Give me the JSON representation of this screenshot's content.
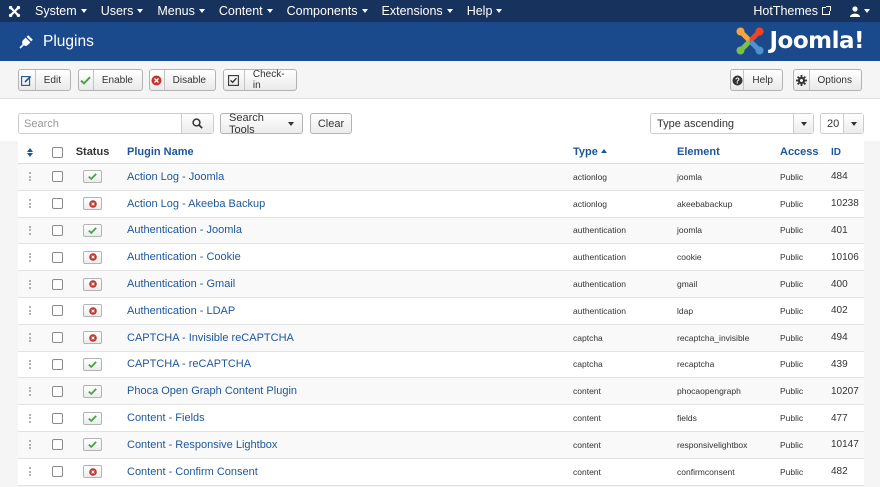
{
  "nav": {
    "menu": [
      "System",
      "Users",
      "Menus",
      "Content",
      "Components",
      "Extensions",
      "Help"
    ],
    "site_name": "HotThemes"
  },
  "header": {
    "title": "Plugins",
    "brand": "Joomla!"
  },
  "toolbar": {
    "edit": "Edit",
    "enable": "Enable",
    "disable": "Disable",
    "checkin": "Check-in",
    "help": "Help",
    "options": "Options"
  },
  "filters": {
    "search_placeholder": "Search",
    "search_tools": "Search Tools",
    "clear": "Clear",
    "ordering": "Type ascending",
    "limit": "20"
  },
  "columns": {
    "status": "Status",
    "name": "Plugin Name",
    "type": "Type",
    "element": "Element",
    "access": "Access",
    "id": "ID"
  },
  "plugins": [
    {
      "enabled": true,
      "name": "Action Log - Joomla",
      "type": "actionlog",
      "element": "joomla",
      "access": "Public",
      "id": "484"
    },
    {
      "enabled": false,
      "name": "Action Log - Akeeba Backup",
      "type": "actionlog",
      "element": "akeebabackup",
      "access": "Public",
      "id": "10238"
    },
    {
      "enabled": true,
      "name": "Authentication - Joomla",
      "type": "authentication",
      "element": "joomla",
      "access": "Public",
      "id": "401"
    },
    {
      "enabled": false,
      "name": "Authentication - Cookie",
      "type": "authentication",
      "element": "cookie",
      "access": "Public",
      "id": "10106"
    },
    {
      "enabled": false,
      "name": "Authentication - Gmail",
      "type": "authentication",
      "element": "gmail",
      "access": "Public",
      "id": "400"
    },
    {
      "enabled": false,
      "name": "Authentication - LDAP",
      "type": "authentication",
      "element": "ldap",
      "access": "Public",
      "id": "402"
    },
    {
      "enabled": false,
      "name": "CAPTCHA - Invisible reCAPTCHA",
      "type": "captcha",
      "element": "recaptcha_invisible",
      "access": "Public",
      "id": "494"
    },
    {
      "enabled": true,
      "name": "CAPTCHA - reCAPTCHA",
      "type": "captcha",
      "element": "recaptcha",
      "access": "Public",
      "id": "439"
    },
    {
      "enabled": true,
      "name": "Phoca Open Graph Content Plugin",
      "type": "content",
      "element": "phocaopengraph",
      "access": "Public",
      "id": "10207"
    },
    {
      "enabled": true,
      "name": "Content - Fields",
      "type": "content",
      "element": "fields",
      "access": "Public",
      "id": "477"
    },
    {
      "enabled": true,
      "name": "Content - Responsive Lightbox",
      "type": "content",
      "element": "responsivelightbox",
      "access": "Public",
      "id": "10147"
    },
    {
      "enabled": false,
      "name": "Content - Confirm Consent",
      "type": "content",
      "element": "confirmconsent",
      "access": "Public",
      "id": "482"
    }
  ],
  "colors": {
    "navbar": "#17325c",
    "header": "#1a4a8c",
    "link": "#1e5799",
    "enabled": "#46a546",
    "disabled": "#bd362f"
  }
}
